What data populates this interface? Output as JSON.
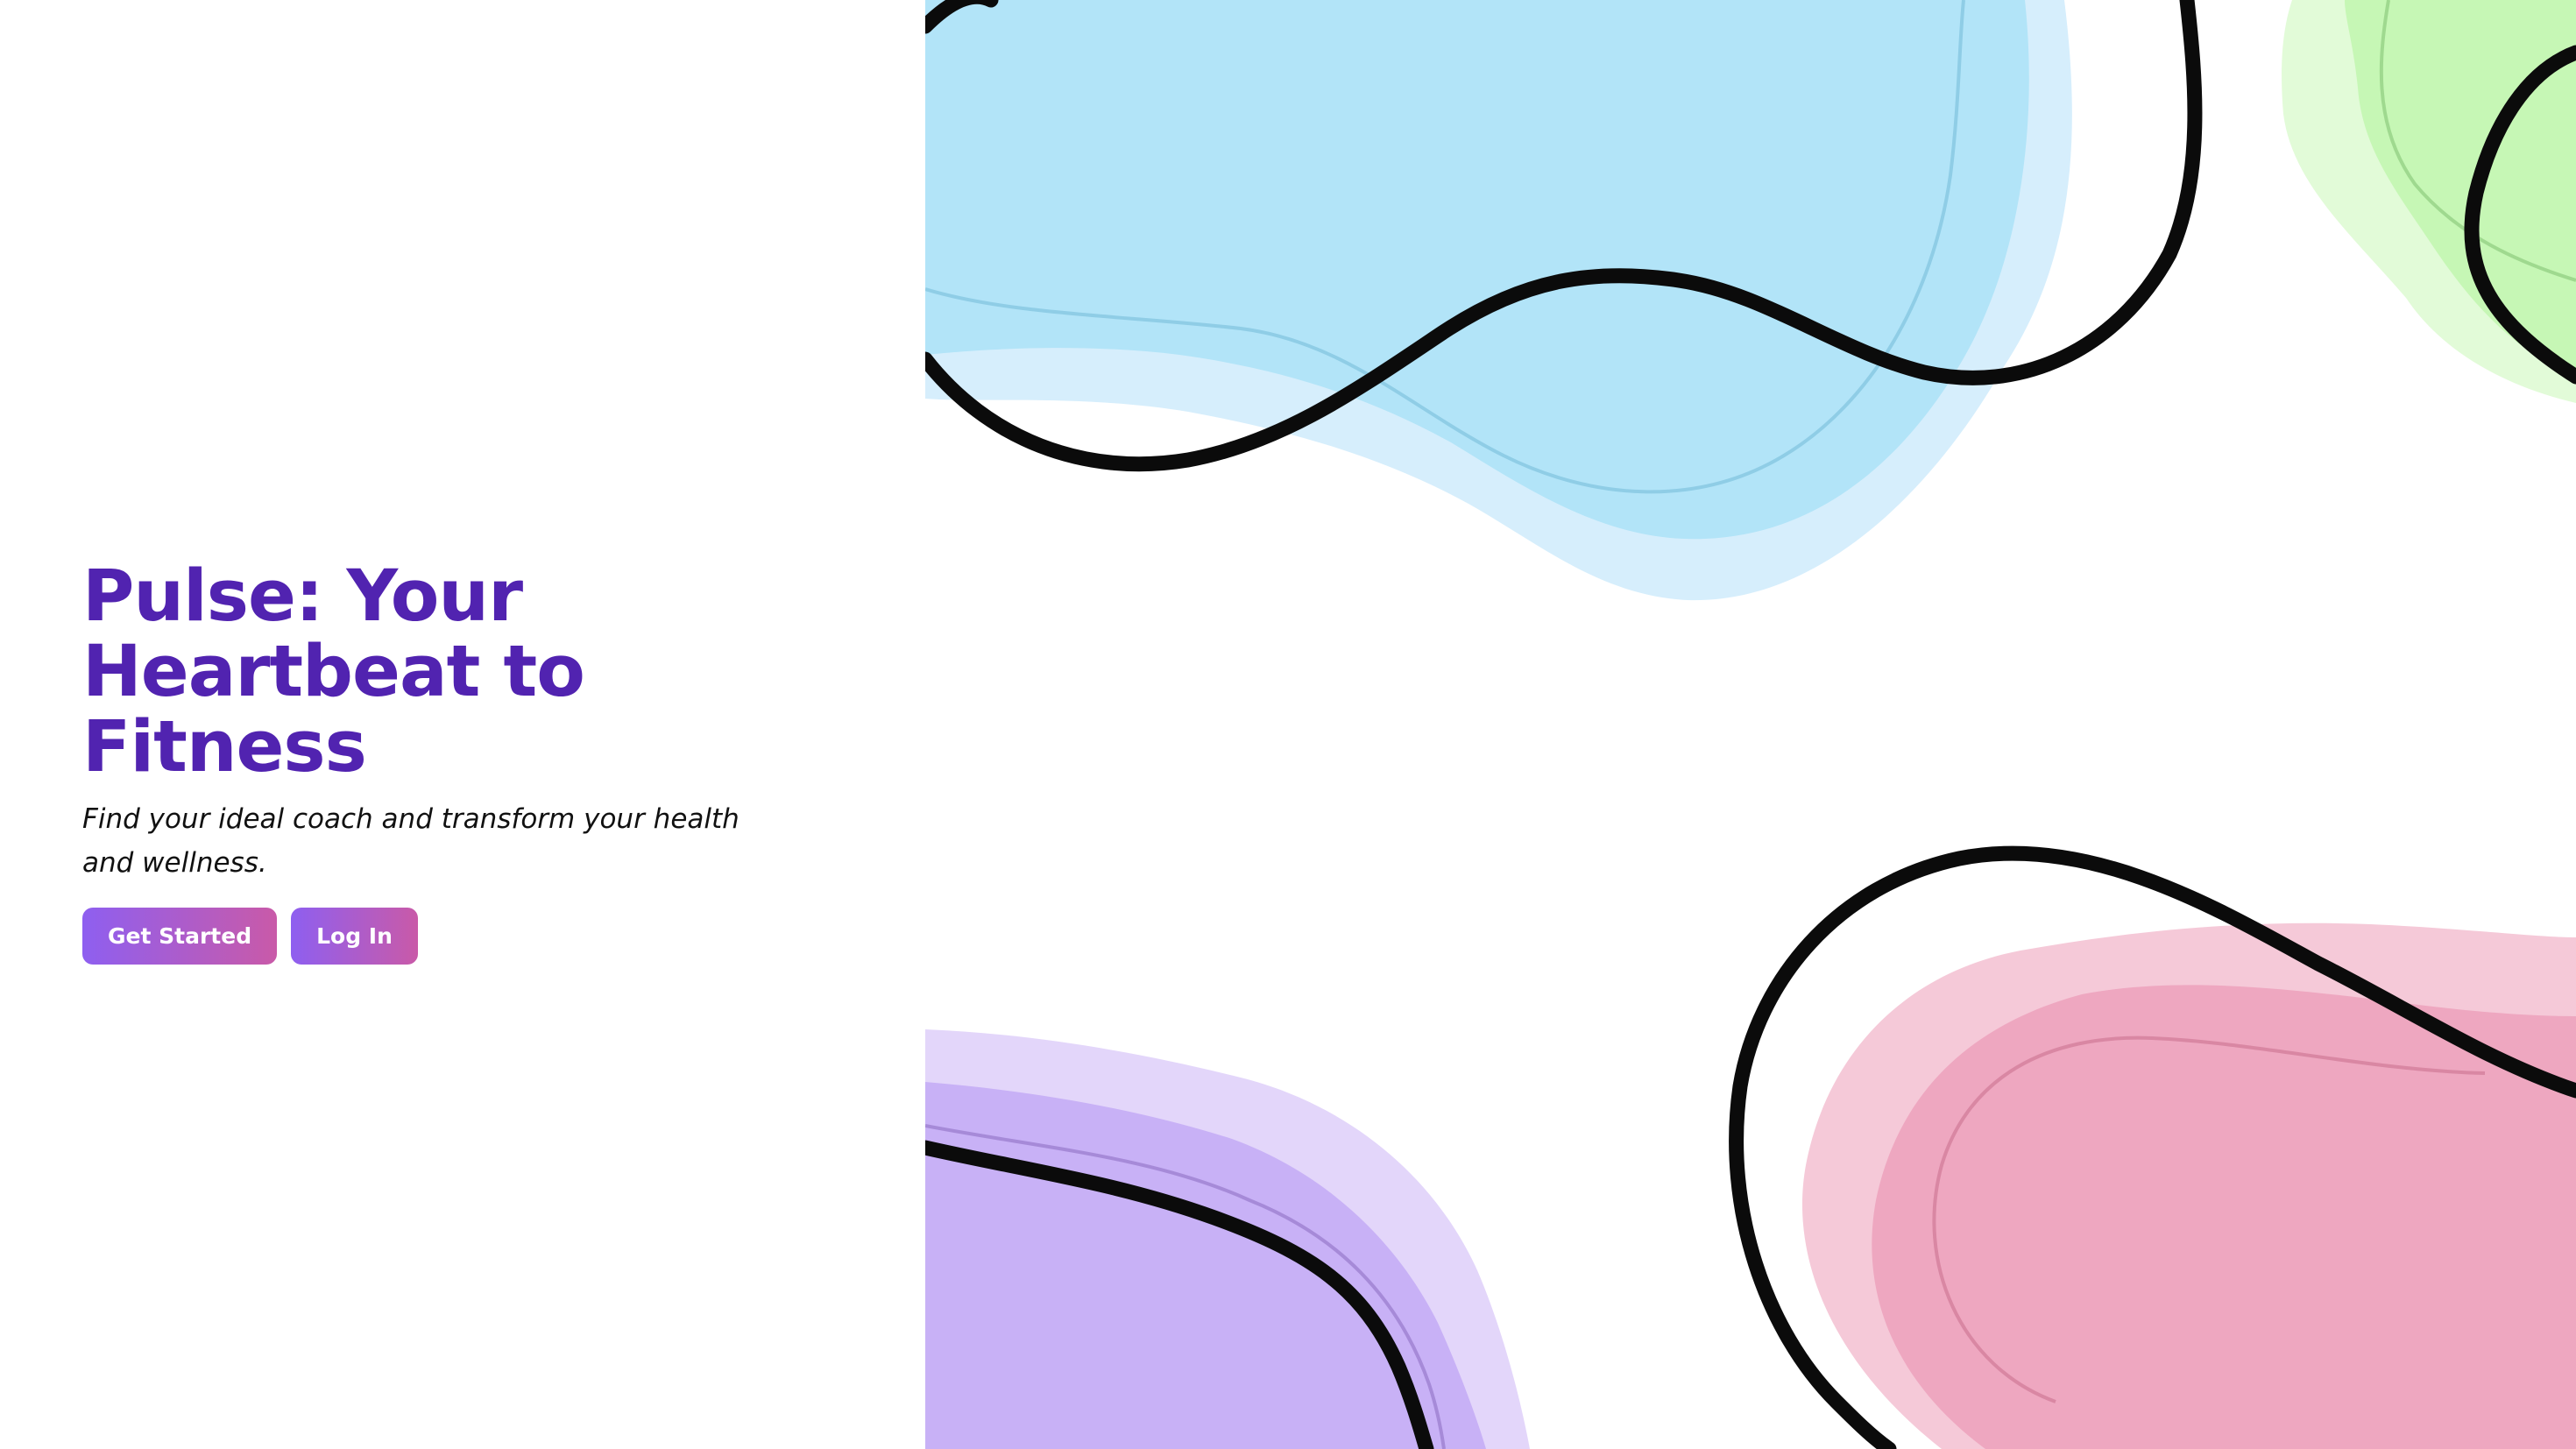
{
  "hero": {
    "title": "Pulse: Your Heartbeat to Fitness",
    "subtitle": "Find your ideal coach and transform your health and wellness.",
    "primary_button": "Get Started",
    "secondary_button": "Log In"
  },
  "colors": {
    "title": "#5123b0",
    "button_gradient_start": "#8e5ff0",
    "button_gradient_end": "#c95aa8",
    "blob_blue": "#b4e4f9",
    "blob_green": "#c5f7b5",
    "blob_pink": "#f0a8c0",
    "blob_purple": "#c8b2f7",
    "outline": "#0b0b0b"
  },
  "decoration": {
    "style": "abstract-hand-drawn-blobs"
  }
}
